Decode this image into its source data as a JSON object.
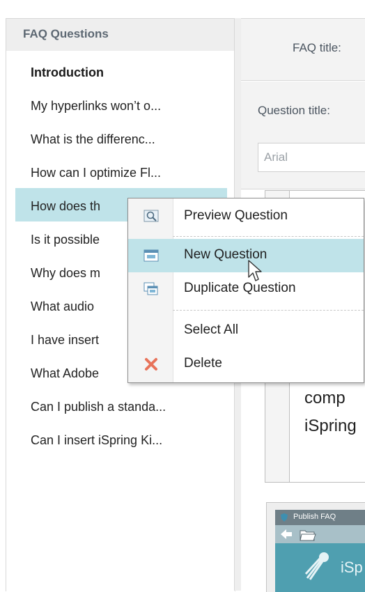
{
  "left_panel": {
    "header": "FAQ Questions",
    "items": [
      {
        "label": "Introduction",
        "bold": true
      },
      {
        "label": "My hyperlinks won’t o..."
      },
      {
        "label": "What is the differenc..."
      },
      {
        "label": "How can I optimize Fl..."
      },
      {
        "label": "How does th",
        "selected": true
      },
      {
        "label": "Is it possible"
      },
      {
        "label": "Why does m"
      },
      {
        "label": "What audio"
      },
      {
        "label": "I have insert"
      },
      {
        "label": "What Adobe"
      },
      {
        "label": "Can I publish a standa..."
      },
      {
        "label": "Can I insert iSpring Ki..."
      }
    ]
  },
  "right_panel": {
    "faq_title_label": "FAQ title:",
    "question_title_label": "Question title:",
    "font_value": "Arial",
    "editor_lines": [
      "comp",
      "iSpring"
    ],
    "preview": {
      "title": "Publish FAQ",
      "brand": "iSp"
    }
  },
  "context_menu": {
    "items": [
      {
        "label": "Preview Question",
        "icon": "preview-icon"
      },
      {
        "label": "New Question",
        "icon": "new-question-icon",
        "hover": true
      },
      {
        "label": "Duplicate Question",
        "icon": "duplicate-icon"
      },
      {
        "label": "Select All",
        "icon": ""
      },
      {
        "label": "Delete",
        "icon": "delete-x-icon"
      }
    ]
  },
  "colors": {
    "selection": "#bfe3e9",
    "delete_icon": "#e8735a",
    "preview_teal": "#4f9fb0"
  }
}
